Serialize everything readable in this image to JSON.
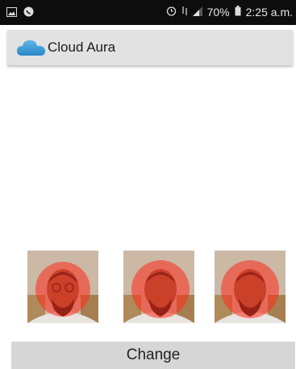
{
  "status_bar": {
    "battery": "70%",
    "time": "2:25 a.m.",
    "icons": [
      "gallery-icon",
      "whatsapp-icon",
      "alarm-icon",
      "network-icon",
      "signal-icon",
      "battery-icon"
    ]
  },
  "app_bar": {
    "title": "Cloud Aura",
    "logo_icon": "cloud-icon",
    "accent": "#3a9bd8"
  },
  "thumbnails": [
    {
      "name": "aura-photo-1"
    },
    {
      "name": "aura-photo-2"
    },
    {
      "name": "aura-photo-3"
    }
  ],
  "colors": {
    "aura": "#ff2a1a",
    "button_bg": "#d6d6d6",
    "appbar_bg": "#e2e2e2"
  },
  "button": {
    "label": "Change"
  }
}
